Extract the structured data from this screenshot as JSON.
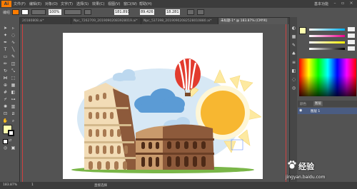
{
  "app": {
    "logo": "Ai",
    "workspace": "基本功能"
  },
  "menu": [
    "文件(F)",
    "编辑(E)",
    "对象(O)",
    "文字(T)",
    "选择(S)",
    "效果(C)",
    "视图(V)",
    "窗口(W)",
    "帮助(H)"
  ],
  "control": {
    "selection_label": "编组",
    "opacity_value": "100%",
    "x_value": "181.891",
    "y_value": "89.426",
    "w_value": "18.281"
  },
  "tabs": [
    {
      "label": "20180808.ai*",
      "active": false
    },
    {
      "label": "Npc_7262709_20190902083928019.ai*",
      "active": false
    },
    {
      "label": "Npc_537398_20190902082528010880.ai*",
      "active": false
    },
    {
      "label": "未标题-1* @ 183.87% (CMYK)",
      "active": true
    }
  ],
  "status": {
    "zoom": "183.87%",
    "page": "1",
    "tool": "直接选择"
  },
  "panel": {
    "color_tab": "颜色",
    "layers_tab": "图层",
    "layer_name": "图层 1",
    "c_value": "",
    "m_value": "",
    "y_value": "",
    "k_value": ""
  },
  "watermark": {
    "brand": "经验",
    "url": "jingyan.baidu.com"
  },
  "colors": {
    "accent": "#ff7c00",
    "sun": "#f7b731",
    "balloon": "#e23b2e",
    "sky": "#d7e8f5",
    "cloud": "#5b9bd5",
    "colosseum_light": "#f2dcb6",
    "colosseum_dark": "#8d5a3b",
    "grass": "#7ab648"
  }
}
